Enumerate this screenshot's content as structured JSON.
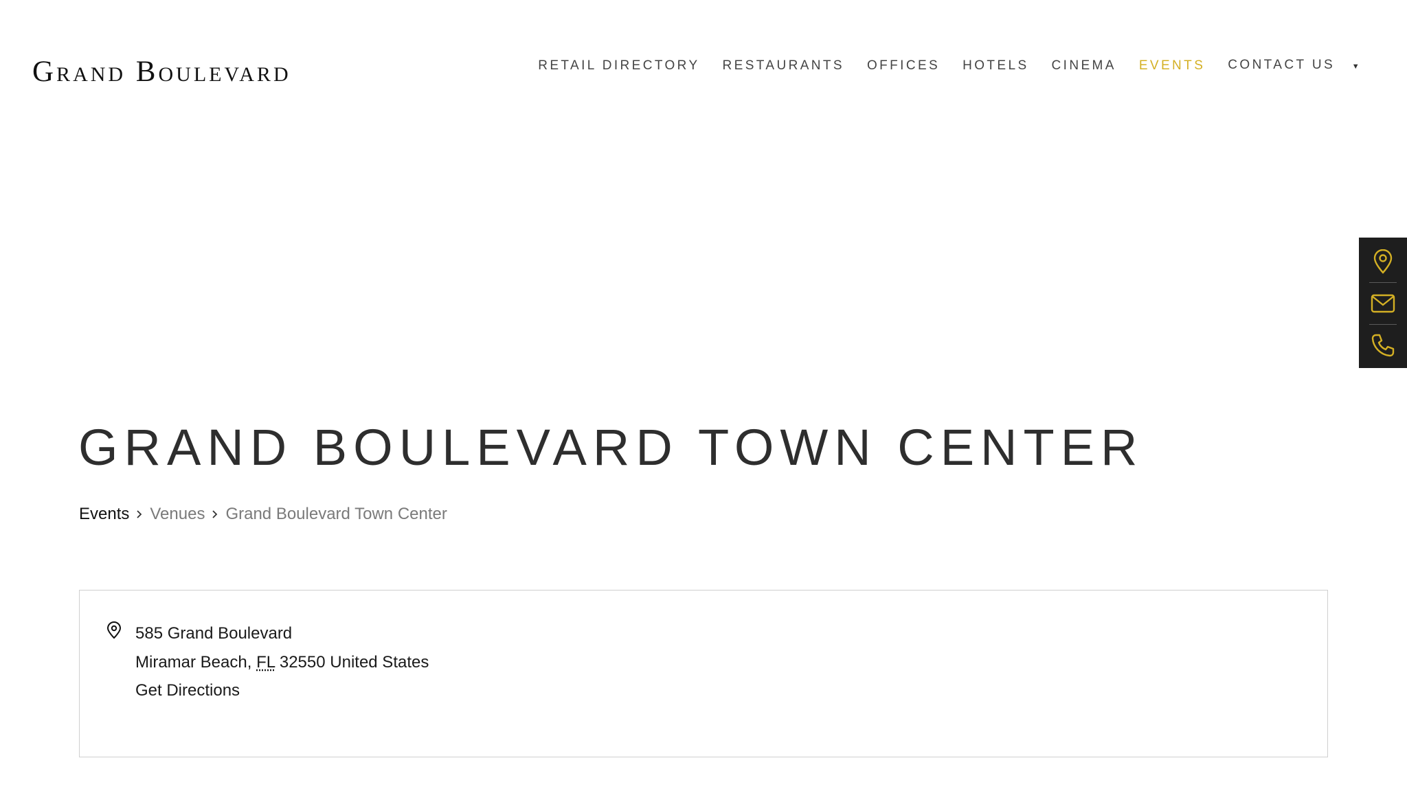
{
  "header": {
    "logo": "Grand Boulevard",
    "nav": [
      {
        "label": "RETAIL DIRECTORY"
      },
      {
        "label": "RESTAURANTS"
      },
      {
        "label": "OFFICES"
      },
      {
        "label": "HOTELS"
      },
      {
        "label": "CINEMA"
      },
      {
        "label": "EVENTS",
        "active": true
      },
      {
        "label": "CONTACT US",
        "has_dropdown": true
      }
    ],
    "active_color": "#d4b024"
  },
  "sidebar": {
    "icons": [
      "map-pin-icon",
      "envelope-icon",
      "phone-icon"
    ],
    "icon_color": "#d4b024",
    "background": "#1e1e1e"
  },
  "page": {
    "title": "GRAND BOULEVARD TOWN CENTER"
  },
  "breadcrumb": {
    "home": "Events",
    "parent": "Venues",
    "current": "Grand Boulevard Town Center"
  },
  "venue": {
    "street": "585 Grand Boulevard",
    "city": "Miramar Beach,",
    "state": "FL",
    "zip_country": "32550 United States",
    "directions": "Get Directions"
  }
}
